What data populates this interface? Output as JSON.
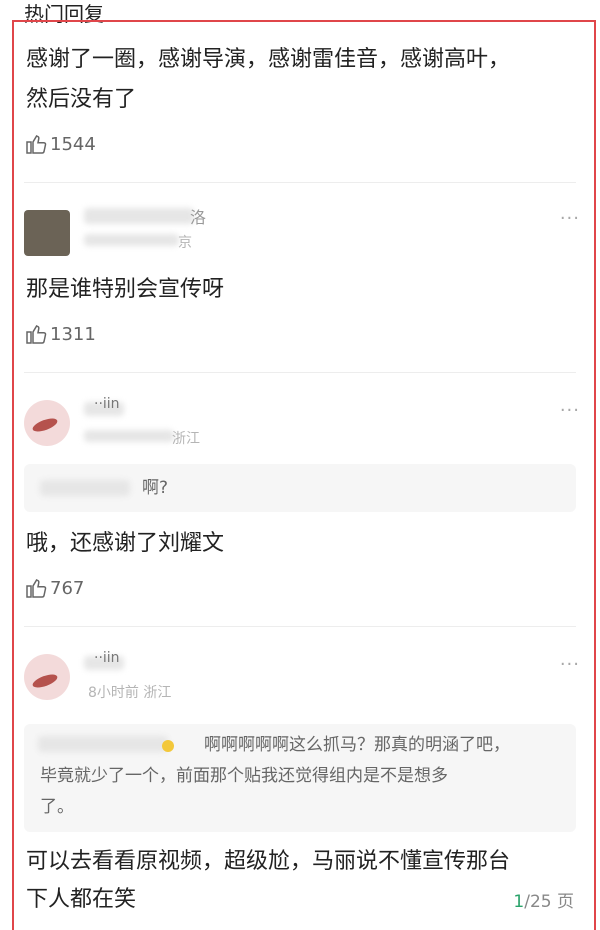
{
  "section_title": "热门回复",
  "post": {
    "line1": "感谢了一圈，感谢导演，感谢雷佳音，感谢高叶，",
    "line2": "然后没有了",
    "likes": "1544"
  },
  "replies": [
    {
      "name_partial": "洛",
      "meta_partial": "京",
      "text": "那是谁特别会宣传呀",
      "likes": "1311",
      "more": "···"
    },
    {
      "name_partial": "··iin",
      "meta_partial": "浙江",
      "quote_text": "啊?",
      "text": "哦，还感谢了刘耀文",
      "likes": "767",
      "more": "···"
    },
    {
      "name_partial": "··iin",
      "meta": "8小时前 浙江",
      "quote_line1": "啊啊啊啊啊这么抓马？那真的明涵了吧，",
      "quote_line2": "毕竟就少了一个，前面那个贴我还觉得组内是不是想多",
      "quote_line3": "了。",
      "text_line1": "可以去看看原视频，超级尬，马丽说不懂宣传那台",
      "text_line2": "下人都在笑",
      "more": "···"
    }
  ],
  "pager": {
    "current": "1",
    "total": "/25 页"
  },
  "colors": {
    "frame": "#e0464a",
    "accent": "#2aa36a"
  }
}
